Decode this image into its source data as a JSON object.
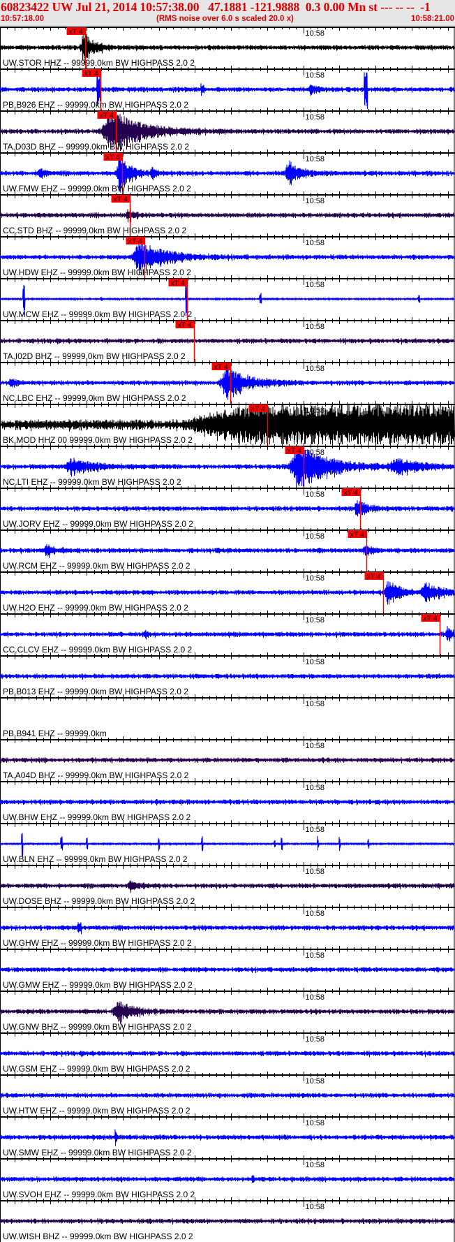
{
  "header": {
    "title": "60823422 UW Jul 21, 2014 10:57:38.00   47.1881 -121.9888  0.3 0.00 Mn st --- -- --  -1",
    "start_time": "10:57:18.00",
    "end_time": "10:58:21.00",
    "note": "(RMS noise over 6.0 s scaled 20.0 x)"
  },
  "axis": {
    "minute_label": "10:58",
    "window_seconds": 63
  },
  "colors": {
    "pick": "#ff0000",
    "black": "#000000",
    "blue": "#0000ff",
    "purple": "#24004f",
    "header_bg": "#e6e6e6"
  },
  "pick_label": "xT 4",
  "traces": [
    {
      "label": "UW.STOR HHZ -- 99999.0km BW  HIGHPASS  2.0  2",
      "color": "black",
      "pick": "10:57:29.8"
    },
    {
      "label": "PB.B926 EHZ -- 99999.0km BW  HIGHPASS  2.0  2",
      "color": "blue",
      "pick": "10:57:31.9"
    },
    {
      "label": "TA.D03D BHZ -- 99999.0km BW  HIGHPASS  2.0  2",
      "color": "purple",
      "pick": "10:57:34.0"
    },
    {
      "label": "UW.FMW EHZ -- 99999.0km BW  HIGHPASS  2.0  2",
      "color": "blue",
      "pick": "10:57:34.9"
    },
    {
      "label": "CC.STD BHZ -- 99999.0km BW  HIGHPASS  2.0  2",
      "color": "purple",
      "pick": "10:57:36.0"
    },
    {
      "label": "UW.HDW EHZ -- 99999.0km BW  HIGHPASS  2.0  2",
      "color": "blue",
      "pick": "10:57:38.0"
    },
    {
      "label": "UW.MCW EHZ -- 99999.0km BW  HIGHPASS  2.0  2",
      "color": "blue",
      "pick": "10:57:43.9"
    },
    {
      "label": "TA.I02D BHZ -- 99999.0km BW  HIGHPASS  2.0  2",
      "color": "purple",
      "pick": "10:57:44.9"
    },
    {
      "label": "NC.LBC EHZ -- 99999.0km BW  HIGHPASS  2.0  2",
      "color": "blue",
      "pick": "10:57:49.9"
    },
    {
      "label": "BK.MOD HHZ 00 99999.0km BW  HIGHPASS  2.0  2",
      "color": "black",
      "pick": "10:57:55.0"
    },
    {
      "label": "NC.LTI EHZ -- 99999.0km BW  HIGHPASS  2.0  2",
      "color": "blue",
      "pick": "10:58:00.0"
    },
    {
      "label": "UW.JORV EHZ -- 99999.0km BW  HIGHPASS  2.0  2",
      "color": "blue",
      "pick": "10:58:07.9"
    },
    {
      "label": "UW.RCM EHZ -- 99999.0km BW  HIGHPASS  2.0  2",
      "color": "blue",
      "pick": "10:58:08.7"
    },
    {
      "label": "UW.H2O EHZ -- 99999.0km BW  HIGHPASS  2.0  2",
      "color": "blue",
      "pick": "10:58:11.0"
    },
    {
      "label": "CC.CLCV EHZ -- 99999.0km BW  HIGHPASS  2.0  2",
      "color": "blue",
      "pick": "10:58:18.9"
    },
    {
      "label": "PB.B013 EHZ -- 99999.0km BW  HIGHPASS  2.0  2",
      "color": "blue"
    },
    {
      "label": "PB.B941 EHZ -- 99999.0km",
      "color": null
    },
    {
      "label": "TA.A04D BHZ -- 99999.0km BW  HIGHPASS  2.0  2",
      "color": "purple"
    },
    {
      "label": "UW.BHW EHZ -- 99999.0km BW  HIGHPASS  2.0  2",
      "color": "blue"
    },
    {
      "label": "UW.BLN EHZ -- 99999.0km BW  HIGHPASS  2.0  2",
      "color": "blue"
    },
    {
      "label": "UW.DOSE BHZ -- 99999.0km BW  HIGHPASS  2.0  2",
      "color": "purple"
    },
    {
      "label": "UW.GHW EHZ -- 99999.0km BW  HIGHPASS  2.0  2",
      "color": "blue"
    },
    {
      "label": "UW.GMW EHZ -- 99999.0km BW  HIGHPASS  2.0  2",
      "color": "blue"
    },
    {
      "label": "UW.GNW BHZ -- 99999.0km BW  HIGHPASS  2.0  2",
      "color": "purple"
    },
    {
      "label": "UW.GSM EHZ -- 99999.0km BW  HIGHPASS  2.0  2",
      "color": "blue"
    },
    {
      "label": "UW.HTW EHZ -- 99999.0km BW  HIGHPASS  2.0  2",
      "color": "blue"
    },
    {
      "label": "UW.SMW EHZ -- 99999.0km BW  HIGHPASS  2.0  2",
      "color": "blue"
    },
    {
      "label": "UW.SVOH EHZ -- 99999.0km BW  HIGHPASS  2.0  2",
      "color": "blue"
    },
    {
      "label": "UW.WISH BHZ -- 99999.0km BW  HIGHPASS  2.0  2",
      "color": "purple"
    }
  ]
}
